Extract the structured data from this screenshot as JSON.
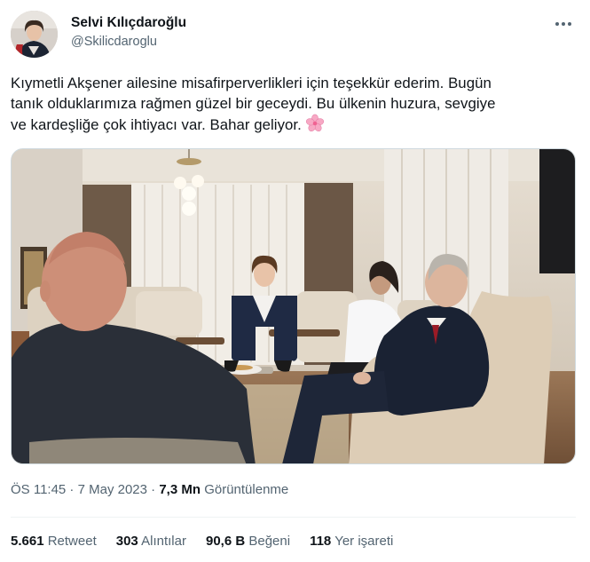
{
  "author": {
    "display_name": "Selvi Kılıçdaroğlu",
    "handle": "@Skilicdaroglu",
    "avatar_icon": "profile-photo"
  },
  "more_icon": "more-horizontal-icon",
  "tweet": {
    "text_lines": [
      "Kıymetli Akşener ailesine misafirperverlikleri için teşekkür ederim. Bugün",
      "tanık olduklarımıza rağmen güzel bir geceydi. Bu ülkenin huzura, sevgiye",
      "ve kardeşliğe çok ihtiyacı var. Bahar geliyor."
    ],
    "emoji": "cherry-blossom-emoji"
  },
  "meta": {
    "time": "ÖS 11:45",
    "separator": " · ",
    "date": "7 May 2023",
    "views_count": "7,3 Mn",
    "views_label": "Görüntülenme"
  },
  "stats": {
    "retweets": {
      "count": "5.661",
      "label": "Retweet"
    },
    "quotes": {
      "count": "303",
      "label": "Alıntılar"
    },
    "likes": {
      "count": "90,6 B",
      "label": "Beğeni"
    },
    "bookmarks": {
      "count": "118",
      "label": "Yer işareti"
    }
  },
  "colors": {
    "text_primary": "#0f1419",
    "text_secondary": "#536471",
    "divider": "#eff3f4",
    "border": "#cfd9de"
  }
}
